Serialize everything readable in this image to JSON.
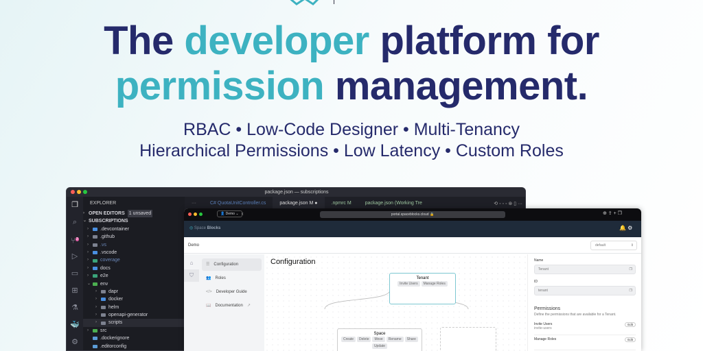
{
  "hero": {
    "title_l1_dark_a": "The ",
    "title_l1_teal": "developer",
    "title_l1_dark_b": " platform for",
    "title_l2_teal": "permission",
    "title_l2_dark": " management.",
    "features_l1": "RBAC • Low-Code Designer • Multi-Tenancy",
    "features_l2": "Hierarchical Permissions • Low Latency • Custom Roles"
  },
  "colors": {
    "navy": "#252a6b",
    "teal": "#3db2c1"
  },
  "vscode": {
    "title": "package.json — subscriptions",
    "explorer": "EXPLORER",
    "open_editors": "OPEN EDITORS",
    "unsaved": "1 unsaved",
    "workspace": "SUBSCRIPTIONS",
    "tree": [
      {
        "name": ".devcontainer",
        "d": 0
      },
      {
        "name": ".github",
        "d": 0
      },
      {
        "name": ".vs",
        "d": 0
      },
      {
        "name": ".vscode",
        "d": 0
      },
      {
        "name": "coverage",
        "d": 0
      },
      {
        "name": "docs",
        "d": 0
      },
      {
        "name": "e2e",
        "d": 0
      },
      {
        "name": "env",
        "d": 0,
        "open": true
      },
      {
        "name": "dapr",
        "d": 1
      },
      {
        "name": "docker",
        "d": 1
      },
      {
        "name": "helm",
        "d": 1
      },
      {
        "name": "openapi-generator",
        "d": 1
      },
      {
        "name": "scripts",
        "d": 1
      },
      {
        "name": "src",
        "d": 0
      },
      {
        "name": ".dockerignore",
        "d": 0,
        "file": true
      },
      {
        "name": ".editorconfig",
        "d": 0,
        "file": true
      }
    ],
    "tabs": [
      {
        "label": "C# QuotaUnitController.cs"
      },
      {
        "label": "package.json M ●"
      },
      {
        "label": ".npmrc M"
      },
      {
        "label": "package.json (Working Tre"
      }
    ],
    "badges": {
      "scm": "3"
    }
  },
  "browser": {
    "profile": "Demo",
    "url": "portal.spaceblocks.cloud",
    "brand_a": "Space",
    "brand_b": "Blocks",
    "breadcrumb": "Demo",
    "select": "default",
    "nav": [
      "Configuration",
      "Roles",
      "Developer Guide",
      "Documentation"
    ],
    "page_title": "Configuration",
    "tenant": {
      "title": "Tenant",
      "chips": [
        "Invite Users",
        "Manage Roles"
      ]
    },
    "space": {
      "title": "Space",
      "chips": [
        "Create",
        "Delete",
        "Move",
        "Rename",
        "Share",
        "Update"
      ]
    },
    "panel": {
      "name_label": "Name",
      "name_value": "Tenant",
      "id_label": "ID",
      "id_value": "tenant",
      "perm_title": "Permissions",
      "perm_desc": "Define the permissions that are available for a Tenant.",
      "perms": [
        {
          "name": "Invite Users",
          "id": "invite-users"
        },
        {
          "name": "Manage Roles",
          "id": ""
        }
      ],
      "edit": "Edit"
    }
  }
}
